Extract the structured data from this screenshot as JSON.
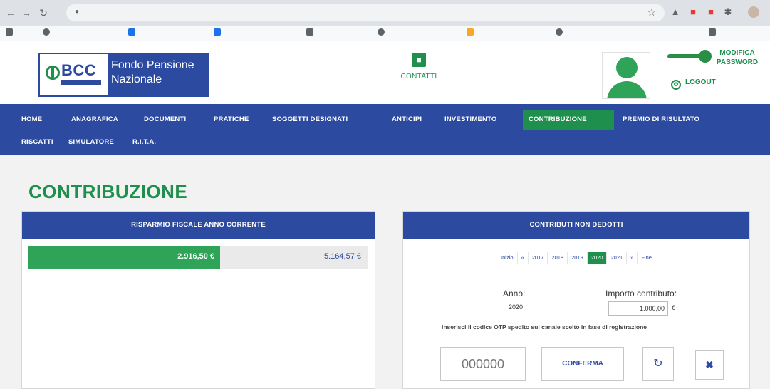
{
  "site": {
    "logo_text": "BCC",
    "logo_title_line1": "Fondo Pensione",
    "logo_title_line2": "Nazionale",
    "contacts_label": "CONTATTI",
    "modifica_line1": "MODIFICA",
    "modifica_line2": "PASSWORD",
    "logout_label": "LOGOUT"
  },
  "nav": {
    "row1": [
      "HOME",
      "ANAGRAFICA",
      "DOCUMENTI",
      "PRATICHE",
      "SOGGETTI DESIGNATI",
      "ANTICIPI",
      "INVESTIMENTO",
      "CONTRIBUZIONE",
      "PREMIO DI RISULTATO"
    ],
    "row2": [
      "RISCATTI",
      "SIMULATORE",
      "R.I.T.A."
    ],
    "active": "CONTRIBUZIONE"
  },
  "page": {
    "title": "CONTRIBUZIONE"
  },
  "risparmio": {
    "heading": "RISPARMIO FISCALE ANNO CORRENTE",
    "value_used": "2.916,50 €",
    "value_total": "5.164,57 €",
    "fill_fraction": 0.565
  },
  "non_dedotti": {
    "heading": "CONTRIBUTI NON DEDOTTI",
    "pager": [
      "Inizio",
      "«",
      "2017",
      "2018",
      "2019",
      "2020",
      "2021",
      "»",
      "Fine"
    ],
    "pager_active": "2020",
    "anno_label": "Anno:",
    "anno_value": "2020",
    "importo_label": "Importo contributo:",
    "importo_value": "1.000,00",
    "importo_currency": "€",
    "otp_text": "Inserisci il codice OTP spedito sul canale scelto in fase di registrazione",
    "otp_placeholder": "000000",
    "confirm_label": "CONFERMA"
  },
  "colors": {
    "primary_blue": "#2b4aa0",
    "accent_green": "#1f8f4d"
  }
}
